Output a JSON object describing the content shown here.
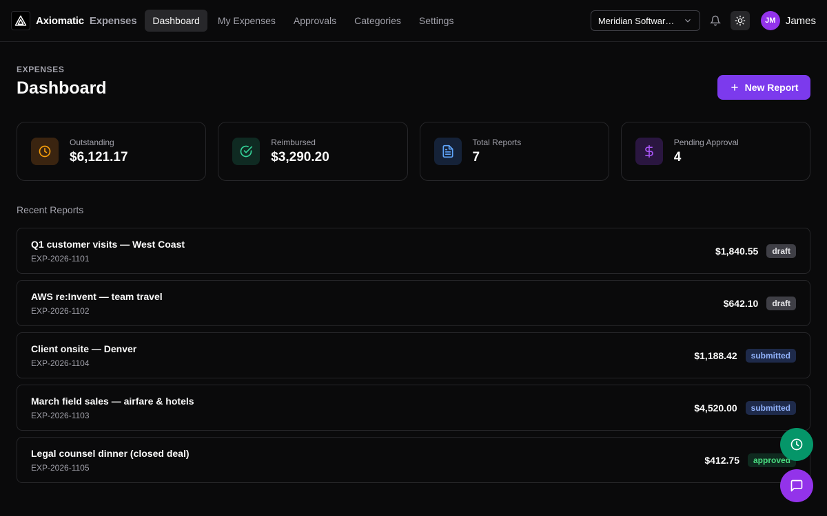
{
  "brand": {
    "name": "Axiomatic",
    "sub": "Expenses"
  },
  "nav": [
    {
      "label": "Dashboard",
      "active": true
    },
    {
      "label": "My Expenses",
      "active": false
    },
    {
      "label": "Approvals",
      "active": false
    },
    {
      "label": "Categories",
      "active": false
    },
    {
      "label": "Settings",
      "active": false
    }
  ],
  "org": {
    "selected": "Meridian Software Inc."
  },
  "user": {
    "initials": "JM",
    "name": "James"
  },
  "page": {
    "eyebrow": "EXPENSES",
    "title": "Dashboard",
    "new_button": "New Report"
  },
  "stats": [
    {
      "label": "Outstanding",
      "value": "$6,121.17",
      "icon": "clock-icon",
      "color": "#f59e0b"
    },
    {
      "label": "Reimbursed",
      "value": "$3,290.20",
      "icon": "check-circle-icon",
      "color": "#34d399"
    },
    {
      "label": "Total Reports",
      "value": "7",
      "icon": "document-icon",
      "color": "#60a5fa"
    },
    {
      "label": "Pending Approval",
      "value": "4",
      "icon": "dollar-icon",
      "color": "#a855f7"
    }
  ],
  "recent": {
    "title": "Recent Reports",
    "items": [
      {
        "title": "Q1 customer visits — West Coast",
        "id": "EXP-2026-1101",
        "amount": "$1,840.55",
        "status": "draft"
      },
      {
        "title": "AWS re:Invent — team travel",
        "id": "EXP-2026-1102",
        "amount": "$642.10",
        "status": "draft"
      },
      {
        "title": "Client onsite — Denver",
        "id": "EXP-2026-1104",
        "amount": "$1,188.42",
        "status": "submitted"
      },
      {
        "title": "March field sales — airfare & hotels",
        "id": "EXP-2026-1103",
        "amount": "$4,520.00",
        "status": "submitted"
      },
      {
        "title": "Legal counsel dinner (closed deal)",
        "id": "EXP-2026-1105",
        "amount": "$412.75",
        "status": "approved"
      }
    ]
  }
}
